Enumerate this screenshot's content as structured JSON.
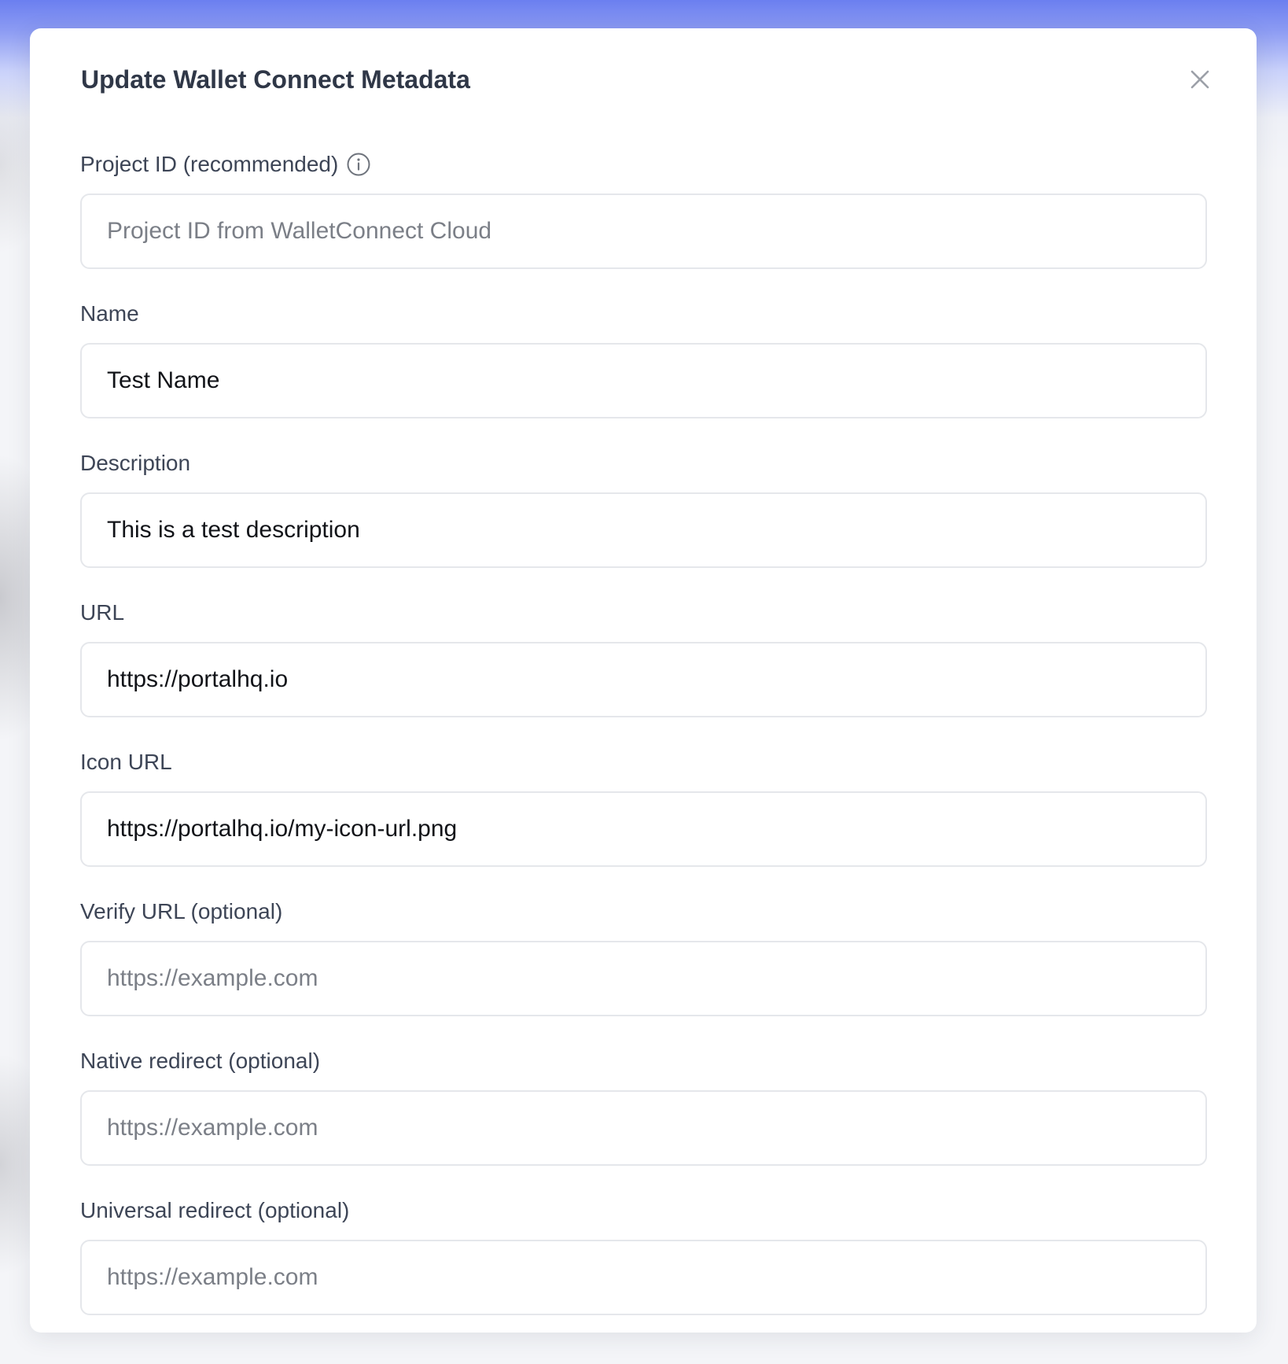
{
  "modal": {
    "title": "Update Wallet Connect Metadata",
    "close_icon": "close-icon"
  },
  "fields": {
    "project_id": {
      "label": "Project ID (recommended)",
      "info_icon": "info-icon",
      "value": "",
      "placeholder": "Project ID from WalletConnect Cloud"
    },
    "name": {
      "label": "Name",
      "value": "Test Name",
      "placeholder": ""
    },
    "description": {
      "label": "Description",
      "value": "This is a test description",
      "placeholder": ""
    },
    "url": {
      "label": "URL",
      "value": "https://portalhq.io",
      "placeholder": ""
    },
    "icon_url": {
      "label": "Icon URL",
      "value": "https://portalhq.io/my-icon-url.png",
      "placeholder": ""
    },
    "verify_url": {
      "label": "Verify URL (optional)",
      "value": "",
      "placeholder": "https://example.com"
    },
    "native_redirect": {
      "label": "Native redirect (optional)",
      "value": "",
      "placeholder": "https://example.com"
    },
    "universal_redirect": {
      "label": "Universal redirect (optional)",
      "value": "",
      "placeholder": "https://example.com"
    }
  },
  "colors": {
    "header_gradient": "#6b7ff0",
    "title_text": "#2f3747",
    "label_text": "#3d4556",
    "input_border": "#e5e7eb",
    "placeholder_text": "#7b7f87",
    "icon_gray": "#9ca0a8"
  }
}
